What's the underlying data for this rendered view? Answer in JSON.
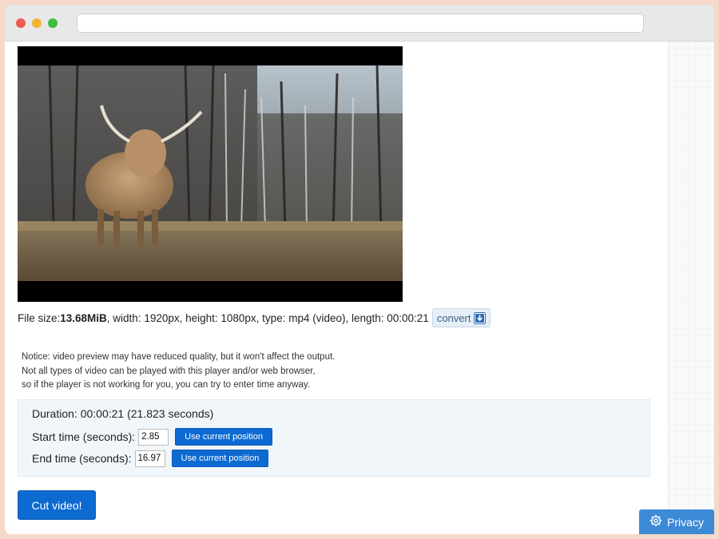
{
  "window": {
    "address_value": ""
  },
  "video": {
    "image_description_icon": "highland-cow-video-frame"
  },
  "file_info": {
    "label_file_size": "File size: ",
    "file_size": "13.68MiB",
    "details": ", width: 1920px, height: 1080px, type: mp4 (video), length: 00:00:21",
    "convert_label": "convert",
    "convert_icon": "download-icon"
  },
  "notice": {
    "line1": "Notice: video preview may have reduced quality, but it won't affect the output.",
    "line2": "Not all types of video can be played with this player and/or web browser,",
    "line3": "so if the player is not working for you, you can try to enter time anyway."
  },
  "panel": {
    "duration": "Duration: 00:00:21 (21.823 seconds)",
    "start_label": "Start time (seconds):",
    "start_value": "2.85",
    "start_button": "Use current position",
    "end_label": "End time (seconds):",
    "end_value": "16.97",
    "end_button": "Use current position"
  },
  "actions": {
    "cut_button": "Cut video!",
    "privacy_button": "Privacy",
    "privacy_icon": "gear-icon"
  },
  "colors": {
    "primary_button": "#0d6ad1",
    "privacy_button": "#3d8ad7",
    "panel_background": "#f1f6fb",
    "page_background": "#f6d9c8"
  }
}
